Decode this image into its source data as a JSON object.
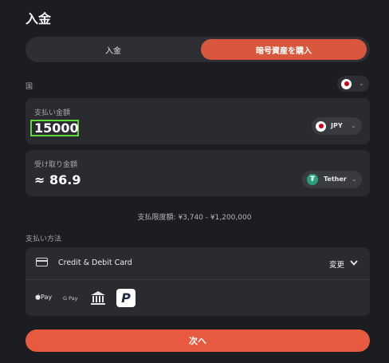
{
  "page": {
    "title": "入金"
  },
  "tabs": [
    {
      "label": "入金",
      "active": false
    },
    {
      "label": "暗号資産を購入",
      "active": true
    }
  ],
  "country": {
    "label": "国",
    "icon": "japan-flag-icon"
  },
  "pay": {
    "label": "支払い金額",
    "value": "15000",
    "currency": "JPY"
  },
  "receive": {
    "label": "受け取り金額",
    "value": "≈ 86.9",
    "currency": "Tether",
    "currency_symbol": "₮"
  },
  "limits": {
    "text": "支払限度額: ¥3,740 - ¥1,200,000"
  },
  "payment_method": {
    "label": "支払い方法",
    "selected": "Credit & Debit Card",
    "change_label": "変更",
    "options": [
      {
        "name": "apple-pay",
        "label": "Pay"
      },
      {
        "name": "google-pay",
        "label": "G Pay"
      },
      {
        "name": "bank-transfer",
        "icon": "bank-icon"
      },
      {
        "name": "paypal",
        "icon": "paypal-icon",
        "glyph": "P"
      }
    ]
  },
  "next_button": {
    "label": "次へ"
  },
  "colors": {
    "accent": "#e85a3f",
    "background": "#1c1d21",
    "card": "#2a2b30",
    "highlight": "#5fd93a",
    "tether": "#26a17b"
  }
}
